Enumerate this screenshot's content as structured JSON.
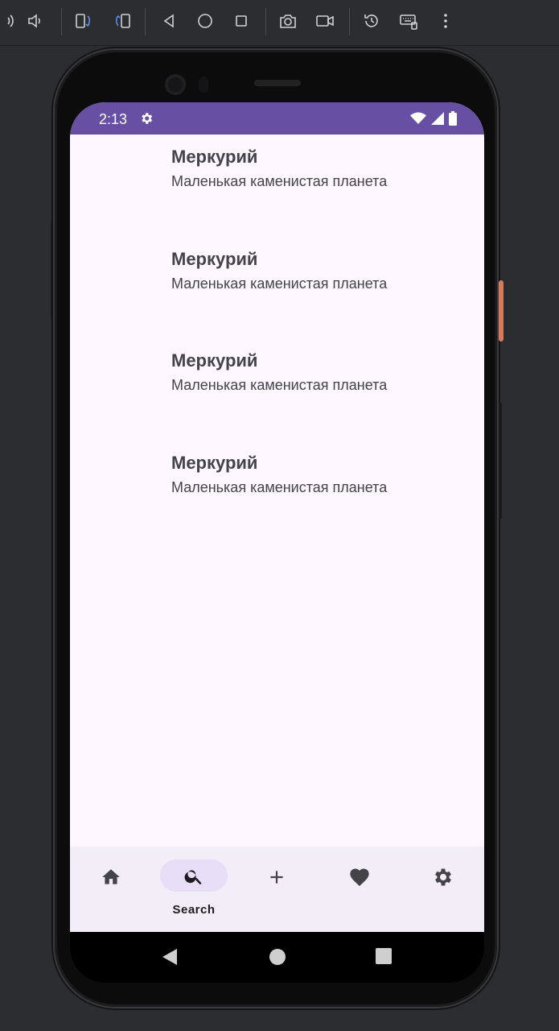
{
  "emulator_toolbar": {
    "icons": [
      "volume-up-icon",
      "volume-down-icon",
      "rotate-left-icon",
      "rotate-right-icon",
      "back-icon",
      "home-icon",
      "overview-icon",
      "screenshot-icon",
      "screen-record-icon",
      "snapshot-icon",
      "keyboard-icon",
      "more-icon"
    ]
  },
  "status_bar": {
    "time": "2:13",
    "color": "#6750a4"
  },
  "list": {
    "items": [
      {
        "title": "Меркурий",
        "subtitle": "Маленькая каменистая планета"
      },
      {
        "title": "Меркурий",
        "subtitle": "Маленькая каменистая планета"
      },
      {
        "title": "Меркурий",
        "subtitle": "Маленькая каменистая планета"
      },
      {
        "title": "Меркурий",
        "subtitle": "Маленькая каменистая планета"
      }
    ]
  },
  "bottom_nav": {
    "items": [
      {
        "icon": "home-icon",
        "label": "",
        "selected": false
      },
      {
        "icon": "search-icon",
        "label": "Search",
        "selected": true
      },
      {
        "icon": "add-icon",
        "label": "",
        "selected": false
      },
      {
        "icon": "heart-icon",
        "label": "",
        "selected": false
      },
      {
        "icon": "settings-icon",
        "label": "",
        "selected": false
      }
    ],
    "background": "#f3edf7",
    "indicator_color": "#e8def8"
  },
  "colors": {
    "screen_background": "#fef7ff",
    "text": "#45434a",
    "accent": "#6750a4"
  }
}
